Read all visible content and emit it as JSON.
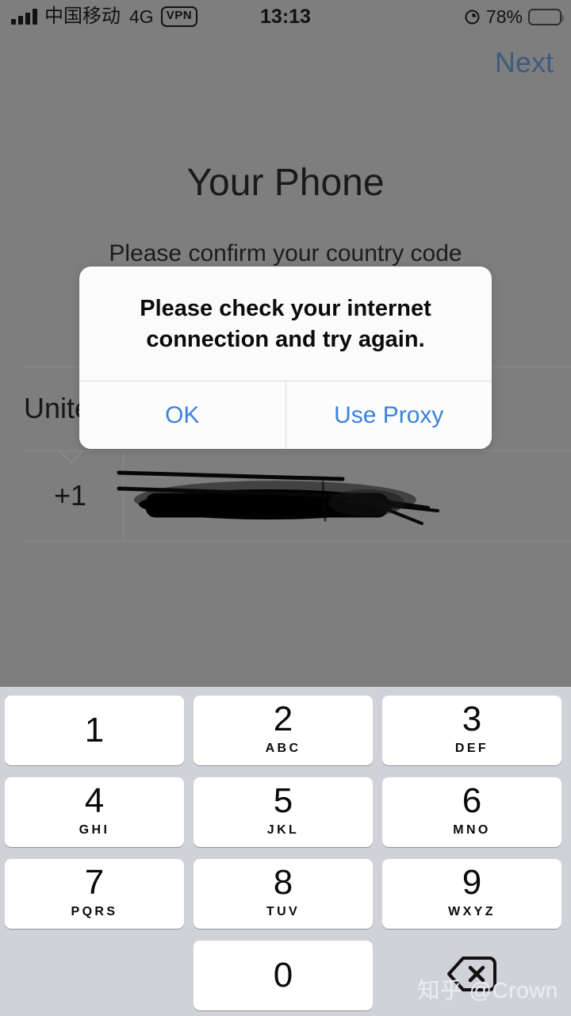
{
  "status_bar": {
    "carrier": "中国移动",
    "network": "4G",
    "vpn_badge": "VPN",
    "time": "13:13",
    "battery_percent": "78%",
    "signal_bars": 4,
    "battery_level": 78
  },
  "nav": {
    "next_label": "Next"
  },
  "screen": {
    "title": "Your Phone",
    "subtitle": "Please confirm your country code",
    "country_name": "United States",
    "country_code": "+1",
    "phone_number_value": "",
    "phone_number_redacted": true
  },
  "alert": {
    "message": "Please check your internet connection and try again.",
    "buttons": [
      {
        "label": "OK"
      },
      {
        "label": "Use Proxy"
      }
    ]
  },
  "keypad": {
    "keys": [
      {
        "digit": "1",
        "letters": ""
      },
      {
        "digit": "2",
        "letters": "ABC"
      },
      {
        "digit": "3",
        "letters": "DEF"
      },
      {
        "digit": "4",
        "letters": "GHI"
      },
      {
        "digit": "5",
        "letters": "JKL"
      },
      {
        "digit": "6",
        "letters": "MNO"
      },
      {
        "digit": "7",
        "letters": "PQRS"
      },
      {
        "digit": "8",
        "letters": "TUV"
      },
      {
        "digit": "9",
        "letters": "WXYZ"
      },
      {
        "digit": "0",
        "letters": ""
      }
    ],
    "backspace_icon": "backspace-icon"
  },
  "watermark": {
    "text": "知乎 @Crown"
  },
  "colors": {
    "dim_overlay": "#7e7e7e",
    "accent_blue": "#3b82d8",
    "next_blue_dimmed": "#3d5c80",
    "keypad_bg": "#d0d2d8",
    "key_bg": "#ffffff",
    "alert_bg": "#fbfbfb"
  }
}
